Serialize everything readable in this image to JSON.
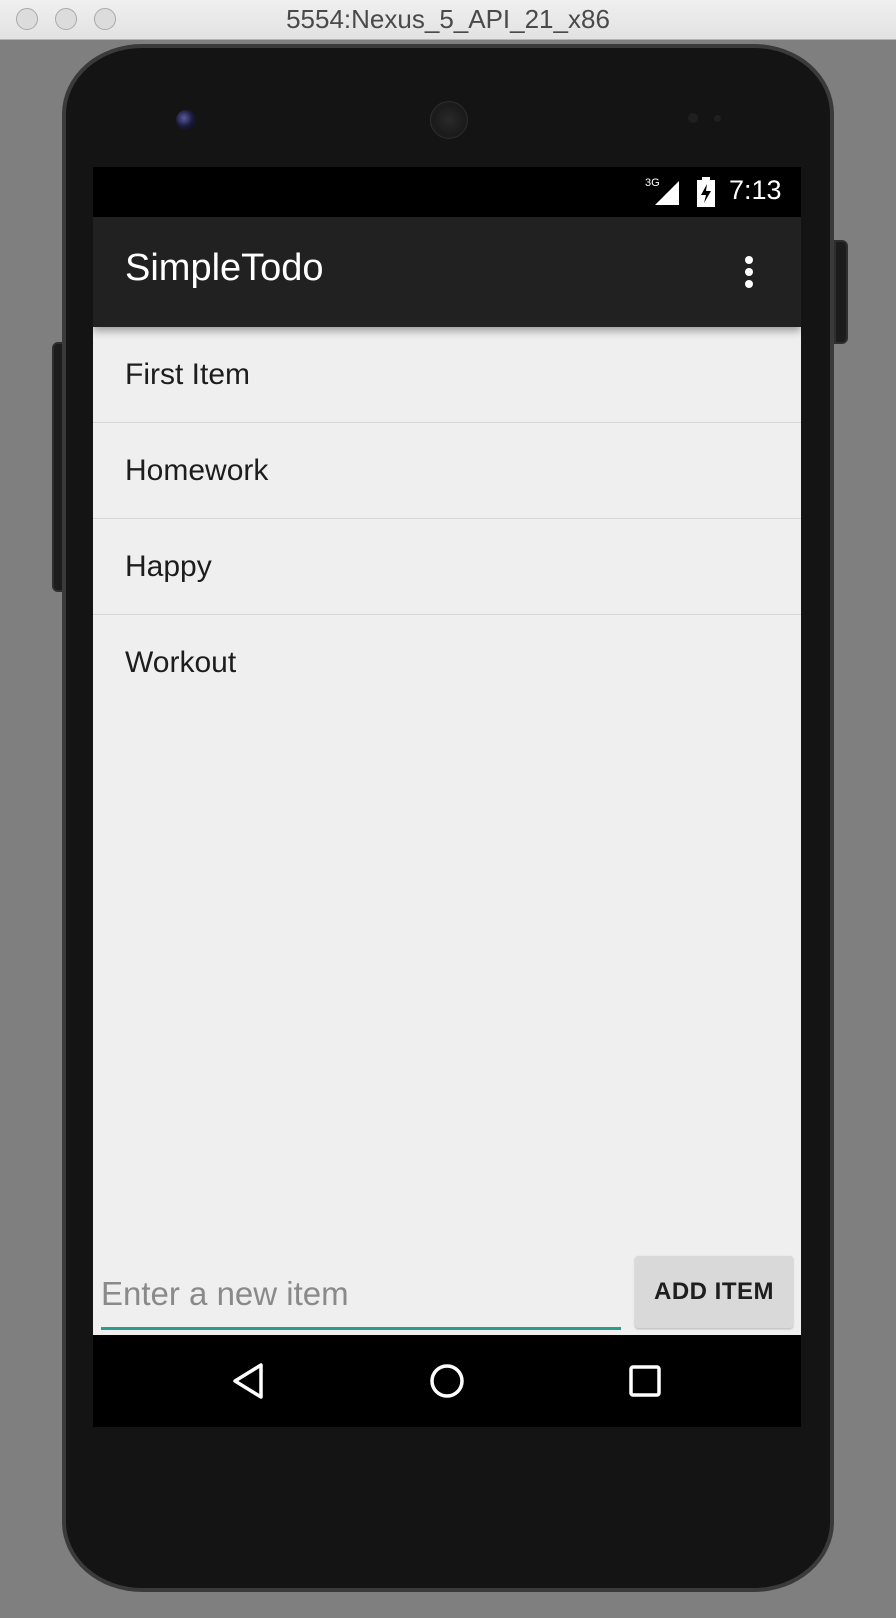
{
  "window": {
    "title": "5554:Nexus_5_API_21_x86"
  },
  "statusbar": {
    "network": "3G",
    "time": "7:13",
    "icons": [
      "signal-icon",
      "battery-icon"
    ]
  },
  "appbar": {
    "title": "SimpleTodo",
    "menu_icon": "overflow-menu-icon"
  },
  "todo_list": {
    "items": [
      {
        "label": "First Item"
      },
      {
        "label": "Homework"
      },
      {
        "label": "Happy"
      },
      {
        "label": "Workout"
      }
    ]
  },
  "new_item": {
    "value": "",
    "placeholder": "Enter a new item",
    "accent_color": "#2a9d8f"
  },
  "add_button": {
    "label": "ADD ITEM"
  },
  "navbar": {
    "icons": [
      "back-icon",
      "home-icon",
      "recents-icon"
    ]
  },
  "colors": {
    "appbar": "#212121",
    "background": "#efefef",
    "statusbar": "#000000"
  }
}
